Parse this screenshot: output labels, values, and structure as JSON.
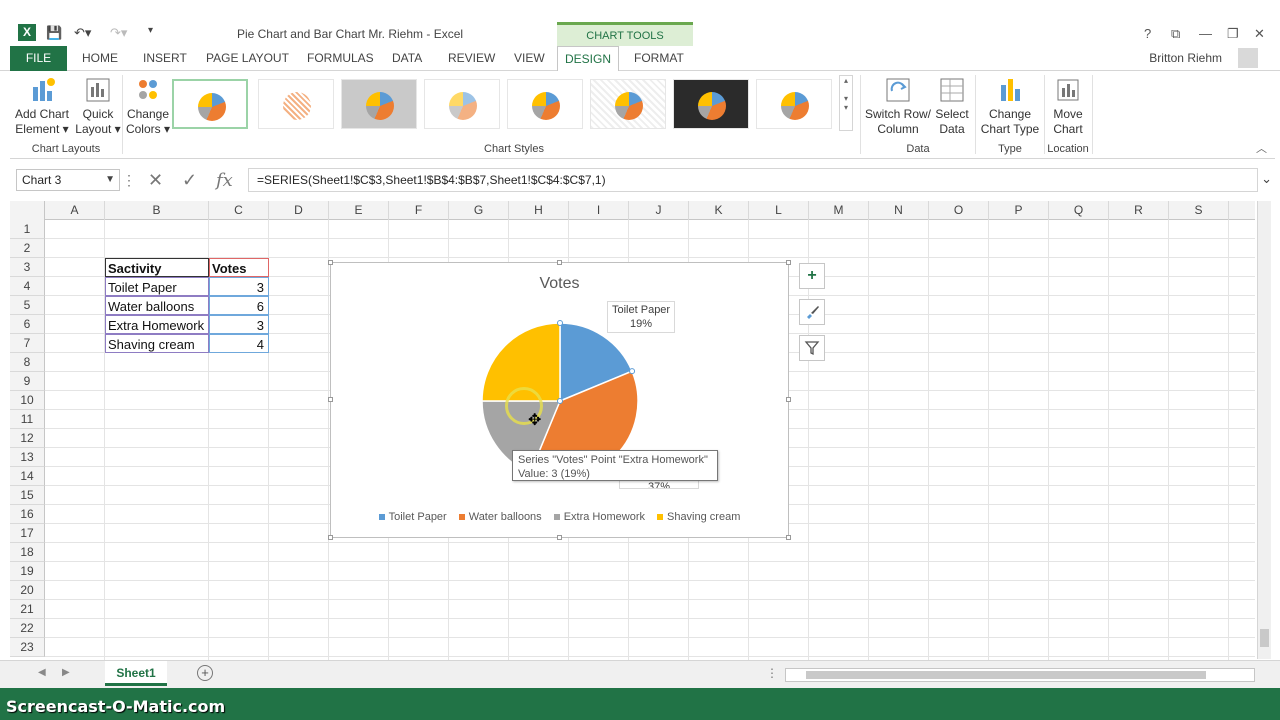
{
  "app": {
    "logo": "X",
    "title": "Pie Chart and Bar Chart Mr. Riehm - Excel",
    "contextual_group": "CHART TOOLS",
    "user": "Britton Riehm",
    "window_controls": [
      "?",
      "⧉",
      "—",
      "❐",
      "✕"
    ]
  },
  "tabs": [
    "FILE",
    "HOME",
    "INSERT",
    "PAGE LAYOUT",
    "FORMULAS",
    "DATA",
    "REVIEW",
    "VIEW",
    "DESIGN",
    "FORMAT"
  ],
  "ribbon": {
    "add_chart_element": "Add Chart",
    "add_chart_element2": "Element",
    "quick_layout": "Quick",
    "quick_layout2": "Layout",
    "change_colors": "Change",
    "change_colors2": "Colors",
    "group_chart_layouts": "Chart Layouts",
    "group_chart_styles": "Chart Styles",
    "switch_row_col": "Switch Row/",
    "switch_row_col2": "Column",
    "select_data": "Select",
    "select_data2": "Data",
    "group_data": "Data",
    "change_chart_type": "Change",
    "change_chart_type2": "Chart Type",
    "group_type": "Type",
    "move_chart": "Move",
    "move_chart2": "Chart",
    "group_location": "Location"
  },
  "formula_bar": {
    "name_box": "Chart 3",
    "formula": "=SERIES(Sheet1!$C$3,Sheet1!$B$4:$B$7,Sheet1!$C$4:$C$7,1)"
  },
  "columns": [
    "A",
    "B",
    "C",
    "D",
    "E",
    "F",
    "G",
    "H",
    "I",
    "J",
    "K",
    "L",
    "M",
    "N",
    "O",
    "P",
    "Q",
    "R",
    "S"
  ],
  "rows": [
    "1",
    "2",
    "3",
    "4",
    "5",
    "6",
    "7",
    "8",
    "9",
    "10",
    "11",
    "12",
    "13",
    "14",
    "15",
    "16",
    "17",
    "18",
    "19",
    "20",
    "21",
    "22",
    "23"
  ],
  "table": {
    "header": [
      "Sactivity",
      "Votes"
    ],
    "rows": [
      [
        "Toilet Paper",
        "3"
      ],
      [
        "Water balloons",
        "6"
      ],
      [
        "Extra Homework",
        "3"
      ],
      [
        "Shaving cream",
        "4"
      ]
    ]
  },
  "chart_data": {
    "type": "pie",
    "title": "Votes",
    "categories": [
      "Toilet Paper",
      "Water balloons",
      "Extra Homework",
      "Shaving cream"
    ],
    "values": [
      3,
      6,
      3,
      4
    ],
    "colors": [
      "#5b9bd5",
      "#ed7d31",
      "#a5a5a5",
      "#ffc000"
    ],
    "legend_position": "bottom",
    "visible_data_label": {
      "category": "Toilet Paper",
      "percent": "19%"
    },
    "partial_data_label": "37%"
  },
  "tooltip": {
    "line1": "Series \"Votes\" Point \"Extra Homework\"",
    "line2": "Value: 3 (19%)"
  },
  "chart_side_buttons": [
    "+",
    "brush",
    "filter"
  ],
  "sheet_tab": "Sheet1",
  "watermark": "Screencast-O-Matic.com"
}
